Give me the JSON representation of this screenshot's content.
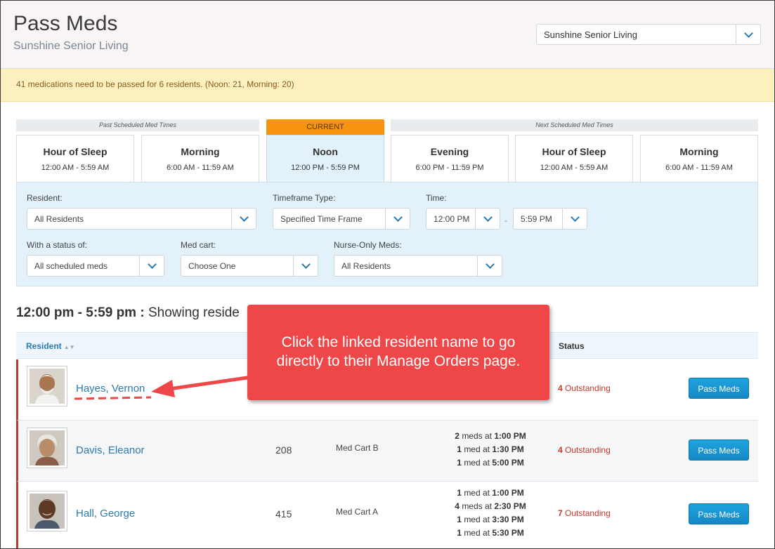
{
  "header": {
    "title": "Pass Meds",
    "subtitle": "Sunshine Senior Living",
    "facility_select": "Sunshine Senior Living"
  },
  "alert": {
    "message": "41 medications need to be passed for 6 residents. (Noon: 21, Morning: 20)"
  },
  "time_tabs": {
    "past_label": "Past Scheduled Med Times",
    "current_label": "CURRENT",
    "next_label": "Next Scheduled Med Times",
    "tabs": [
      {
        "name": "Hour of Sleep",
        "range": "12:00 AM - 5:59 AM"
      },
      {
        "name": "Morning",
        "range": "6:00 AM - 11:59 AM"
      },
      {
        "name": "Noon",
        "range": "12:00 PM - 5:59 PM"
      },
      {
        "name": "Evening",
        "range": "6:00 PM - 11:59 PM"
      },
      {
        "name": "Hour of Sleep",
        "range": "12:00 AM - 5:59 AM"
      },
      {
        "name": "Morning",
        "range": "6:00 AM - 11:59 AM"
      }
    ]
  },
  "filters": {
    "resident_label": "Resident:",
    "resident_value": "All Residents",
    "timeframe_label": "Timeframe Type:",
    "timeframe_value": "Specified Time Frame",
    "time_label": "Time:",
    "time_from": "12:00 PM",
    "time_separator": "-",
    "time_to": "5:59 PM",
    "status_label": "With a status of:",
    "status_value": "All scheduled meds",
    "medcart_label": "Med cart:",
    "medcart_value": "Choose One",
    "nurse_label": "Nurse-Only Meds:",
    "nurse_value": "All Residents"
  },
  "showing": {
    "range": "12:00 pm - 5:59 pm :",
    "text": "Showing reside"
  },
  "table": {
    "col_resident": "Resident",
    "col_status": "Status",
    "pass_label": "Pass Meds",
    "rows": [
      {
        "name": "Hayes, Vernon",
        "room": "",
        "cart": "",
        "status_count": "4",
        "status_text": "Outstanding"
      },
      {
        "name": "Davis, Eleanor",
        "room": "208",
        "cart": "Med Cart B",
        "times": [
          {
            "qty": "2",
            "unit": "meds at",
            "time": "1:00 PM"
          },
          {
            "qty": "1",
            "unit": "med at",
            "time": "1:30 PM"
          },
          {
            "qty": "1",
            "unit": "med at",
            "time": "5:00 PM"
          }
        ],
        "status_count": "4",
        "status_text": "Outstanding"
      },
      {
        "name": "Hall, George",
        "room": "415",
        "cart": "Med Cart A",
        "times": [
          {
            "qty": "1",
            "unit": "med at",
            "time": "1:00 PM"
          },
          {
            "qty": "4",
            "unit": "meds at",
            "time": "2:30 PM"
          },
          {
            "qty": "1",
            "unit": "med at",
            "time": "3:30 PM"
          },
          {
            "qty": "1",
            "unit": "med at",
            "time": "5:30 PM"
          }
        ],
        "status_count": "7",
        "status_text": "Outstanding"
      }
    ]
  },
  "callout": {
    "line1": "Click the linked resident name to go",
    "line2": "directly to their Manage Orders page."
  },
  "colors": {
    "accent_blue": "#2b79b3",
    "current_orange": "#f6940f",
    "outstanding_red": "#c0392b",
    "callout_red": "#ef4648",
    "alert_bg": "#fcf0bf"
  }
}
